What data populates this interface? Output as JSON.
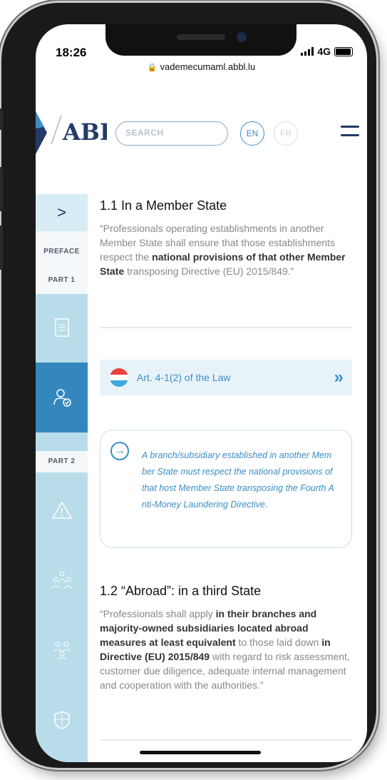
{
  "status": {
    "time": "18:26",
    "network": "4G"
  },
  "url": "vademecumaml.abbl.lu",
  "header": {
    "logo": "ABBL",
    "search_placeholder": "SEARCH",
    "lang_en": "EN",
    "lang_fr": "FR"
  },
  "sidebar": {
    "toggle": ">",
    "preface": "PREFACE",
    "part1": "PART 1",
    "part2": "PART 2"
  },
  "section1": {
    "title": "1.1 In a Member State",
    "text_pre": "“Professionals operating establishments in another Member State shall ensure that those establishments respect the ",
    "text_bold": "national provisions of that other Member State",
    "text_post": " transposing Directive (EU) 2015/849.”"
  },
  "law_link": {
    "label": "Art. 4-1(2) of the Law",
    "arrow": "»"
  },
  "note": {
    "text": "A branch/subsidiary established in another Member State must respect the national provisions of that host Member State transposing the Fourth Anti-Money Laundering Directive."
  },
  "section2": {
    "title": "1.2  “Abroad”: in a third State",
    "t1": "“Professionals shall apply ",
    "b1": "in their branches and majority-owned subsidiaries located abroad measures at least equivalent",
    "t2": " to those laid down ",
    "b2": "in Directive (EU) 2015/849",
    "t3": " with regard to risk assessment, customer due diligence, adequate internal management and cooperation with the authorities.”"
  },
  "colors": {
    "accent": "#3b8ec4",
    "sidebar": "#b8dcea",
    "active": "#3387bd",
    "brand": "#223a66"
  }
}
